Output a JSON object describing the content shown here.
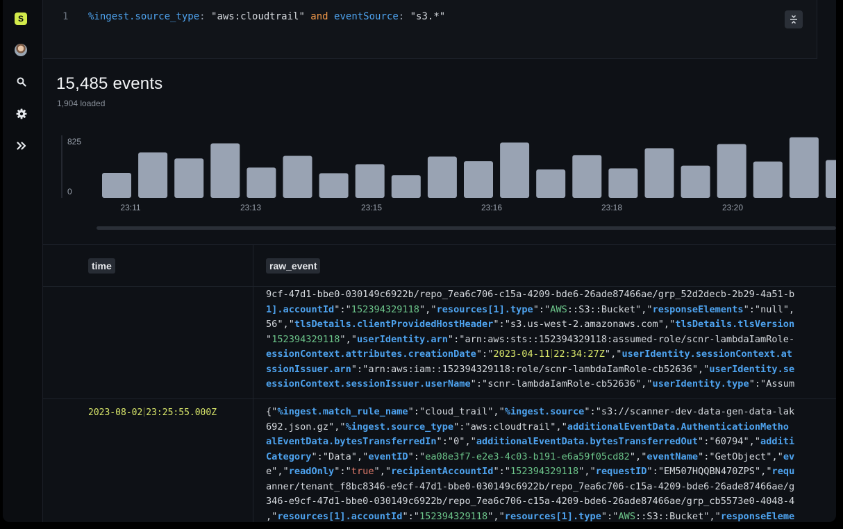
{
  "sidebar": {
    "logo_letter": "S",
    "icons": [
      "logo-icon",
      "avatar",
      "search-icon",
      "gear-icon",
      "expand-icon"
    ]
  },
  "query": {
    "line_number": "1",
    "tokens": [
      {
        "t": "%ingest.source_type",
        "c": "tok-field"
      },
      {
        "t": ": ",
        "c": "tok-op"
      },
      {
        "t": "\"aws:cloudtrail\"",
        "c": "tok-str"
      },
      {
        "t": " and ",
        "c": "tok-kw"
      },
      {
        "t": "eventSource",
        "c": "tok-field"
      },
      {
        "t": ": ",
        "c": "tok-op"
      },
      {
        "t": "\"s3.*\"",
        "c": "tok-str"
      }
    ]
  },
  "summary": {
    "events_total": "15,485 events",
    "loaded": "1,904 loaded"
  },
  "histogram": {
    "y_max_label": "825",
    "y_min_label": "0",
    "y_max": 825,
    "x_labels": [
      "23:11",
      "23:13",
      "23:15",
      "23:16",
      "23:18",
      "23:20"
    ],
    "values": [
      330,
      600,
      520,
      720,
      400,
      555,
      325,
      445,
      300,
      545,
      485,
      730,
      375,
      565,
      390,
      655,
      425,
      710,
      480,
      800,
      500
    ]
  },
  "table": {
    "columns": [
      "time",
      "raw_event"
    ],
    "rows": [
      {
        "time": "",
        "raw_lines": [
          [
            [
              "9cf-47d1-bbe0-030149c6922b/repo_7ea6c706-c15a-4209-bde6-26ade87466ae/grp_52d2decb-2b29-4a51-b",
              "s"
            ]
          ],
          [
            [
              "1].accountId",
              "k"
            ],
            [
              "\":\"",
              "p"
            ],
            [
              "152394329118",
              "n"
            ],
            [
              "\",\"",
              "p"
            ],
            [
              "resources[1].type",
              "k"
            ],
            [
              "\":\"",
              "p"
            ],
            [
              "AWS",
              "ns"
            ],
            [
              "::S3::Bucket",
              "s"
            ],
            [
              "\",\"",
              "p"
            ],
            [
              "responseElements",
              "k"
            ],
            [
              "\":\"null\",",
              "p"
            ]
          ],
          [
            [
              "56\",\"",
              "p"
            ],
            [
              "tlsDetails.clientProvidedHostHeader",
              "k"
            ],
            [
              "\":\"s3.us-west-2.amazonaws.com\",\"",
              "p"
            ],
            [
              "tlsDetails.tlsVersion",
              "k"
            ]
          ],
          [
            [
              "\"",
              "p"
            ],
            [
              "152394329118",
              "n"
            ],
            [
              "\",\"",
              "p"
            ],
            [
              "userIdentity.arn",
              "k"
            ],
            [
              "\":\"arn:aws:sts::152394329118:assumed-role/scnr-lambdaIamRole-",
              "p"
            ]
          ],
          [
            [
              "essionContext.attributes.creationDate",
              "k"
            ],
            [
              "\":\"",
              "p"
            ],
            [
              "2023-04-11⁒22:34:27Z",
              "date"
            ],
            [
              "\",\"",
              "p"
            ],
            [
              "userIdentity.sessionContext.at",
              "k"
            ]
          ],
          [
            [
              "ssionIssuer.arn",
              "k"
            ],
            [
              "\":\"arn:aws:iam::152394329118:role/scnr-lambdaIamRole-cb52636\",\"",
              "p"
            ],
            [
              "userIdentity.se",
              "k"
            ]
          ],
          [
            [
              "essionContext.sessionIssuer.userName",
              "k"
            ],
            [
              "\":\"scnr-lambdaIamRole-cb52636\",\"",
              "p"
            ],
            [
              "userIdentity.type",
              "k"
            ],
            [
              "\":\"Assum",
              "p"
            ]
          ]
        ]
      },
      {
        "time": "2023-08-02⁒23:25:55.000Z",
        "raw_lines": [
          [
            [
              "{\"",
              "p"
            ],
            [
              "%ingest.match_rule_name",
              "k"
            ],
            [
              "\":\"cloud_trail\",\"",
              "p"
            ],
            [
              "%ingest.source",
              "k"
            ],
            [
              "\":\"s3://scanner-dev-data-gen-data-lak",
              "p"
            ]
          ],
          [
            [
              "692.json.gz\",\"",
              "p"
            ],
            [
              "%ingest.source_type",
              "k"
            ],
            [
              "\":\"aws:cloudtrail\",\"",
              "p"
            ],
            [
              "additionalEventData.AuthenticationMetho",
              "k"
            ]
          ],
          [
            [
              "alEventData.bytesTransferredIn",
              "k"
            ],
            [
              "\":\"0\",\"",
              "p"
            ],
            [
              "additionalEventData.bytesTransferredOut",
              "k"
            ],
            [
              "\":\"60794\",\"",
              "p"
            ],
            [
              "additi",
              "k"
            ]
          ],
          [
            [
              "Category",
              "k"
            ],
            [
              "\":\"Data\",\"",
              "p"
            ],
            [
              "eventID",
              "k"
            ],
            [
              "\":\"",
              "p"
            ],
            [
              "ea08e3f7-e2e3-4c03-b191-e6a59f05cd82",
              "n"
            ],
            [
              "\",\"",
              "p"
            ],
            [
              "eventName",
              "k"
            ],
            [
              "\":\"GetObject\",\"",
              "p"
            ],
            [
              "ev",
              "k"
            ]
          ],
          [
            [
              "e\",\"",
              "p"
            ],
            [
              "readOnly",
              "k"
            ],
            [
              "\":\"",
              "p"
            ],
            [
              "true",
              "lit"
            ],
            [
              "\",\"",
              "p"
            ],
            [
              "recipientAccountId",
              "k"
            ],
            [
              "\":\"",
              "p"
            ],
            [
              "152394329118",
              "n"
            ],
            [
              "\",\"",
              "p"
            ],
            [
              "requestID",
              "k"
            ],
            [
              "\":\"EM507HQQBN470ZPS\",\"",
              "p"
            ],
            [
              "requ",
              "k"
            ]
          ],
          [
            [
              "anner/tenant_f8bc8346-e9cf-47d1-bbe0-030149c6922b/repo_7ea6c706-c15a-4209-bde6-26ade87466ae/g",
              "s"
            ]
          ],
          [
            [
              "346-e9cf-47d1-bbe0-030149c6922b/repo_7ea6c706-c15a-4209-bde6-26ade87466ae/grp_cb5573e0-4048-4",
              "s"
            ]
          ],
          [
            [
              ",\"",
              "p"
            ],
            [
              "resources[1].accountId",
              "k"
            ],
            [
              "\":\"",
              "p"
            ],
            [
              "152394329118",
              "n"
            ],
            [
              "\",\"",
              "p"
            ],
            [
              "resources[1].type",
              "k"
            ],
            [
              "\":\"",
              "p"
            ],
            [
              "AWS",
              "ns"
            ],
            [
              "::S3::Bucket\",\"",
              "s"
            ],
            [
              "responseEleme",
              "k"
            ]
          ]
        ]
      }
    ]
  },
  "colors": {
    "accent_blue": "#4ea3ef",
    "keyword_orange": "#f2994a",
    "number_green": "#6cc58a",
    "date_yellow": "#d8e66a",
    "bar_gray": "#99a3b3",
    "logo_lime": "#d2ea4b"
  }
}
